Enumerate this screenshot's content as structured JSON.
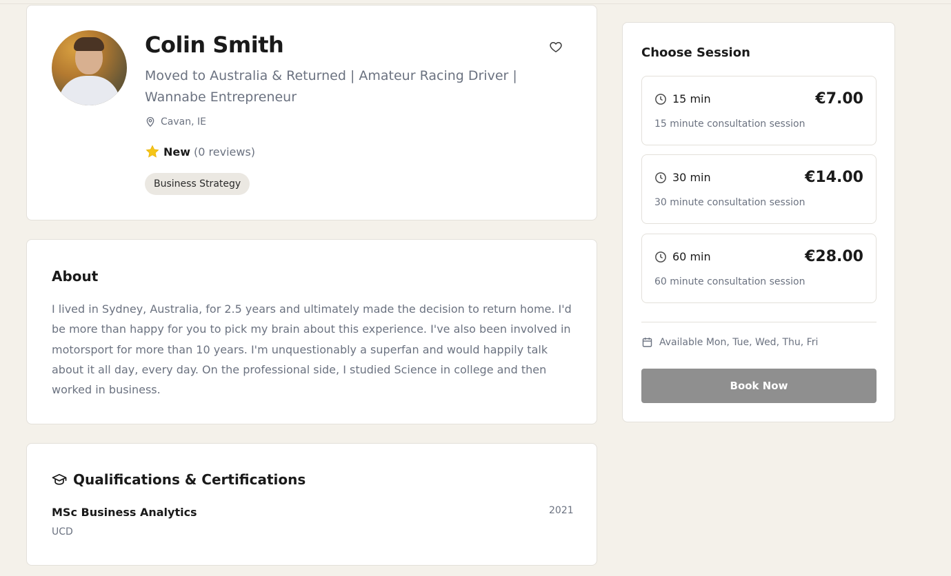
{
  "profile": {
    "name": "Colin Smith",
    "headline": "Moved to Australia & Returned | Amateur Racing Driver | Wannabe Entrepreneur",
    "location": "Cavan, IE",
    "rating_label": "New",
    "reviews": "(0 reviews)",
    "tag": "Business Strategy",
    "icons": {
      "favorite": "heart-icon",
      "location": "map-pin-icon",
      "rating": "star-icon"
    }
  },
  "about": {
    "title": "About",
    "text": "I lived in Sydney, Australia, for 2.5 years and ultimately made the decision to return home. I'd be more than happy for you to pick my brain about this experience. I've also been involved in motorsport for more than 10 years. I'm unquestionably a superfan and would happily talk about it all day, every day. On the professional side, I studied Science in college and then worked in business."
  },
  "qualifications": {
    "title": "Qualifications & Certifications",
    "items": [
      {
        "name": "MSc Business Analytics",
        "institution": "UCD",
        "year": "2021"
      }
    ]
  },
  "session": {
    "title": "Choose Session",
    "options": [
      {
        "duration": "15 min",
        "price": "€7.00",
        "description": "15 minute consultation session"
      },
      {
        "duration": "30 min",
        "price": "€14.00",
        "description": "30 minute consultation session"
      },
      {
        "duration": "60 min",
        "price": "€28.00",
        "description": "60 minute consultation session"
      }
    ],
    "availability": "Available Mon, Tue, Wed, Thu, Fri",
    "book_label": "Book Now"
  },
  "colors": {
    "background": "#f4f1ea",
    "card": "#ffffff",
    "muted_text": "#6b7280",
    "star": "#f5c518",
    "book_button": "#8f8f8f",
    "tag_bg": "#ebe8e2"
  }
}
